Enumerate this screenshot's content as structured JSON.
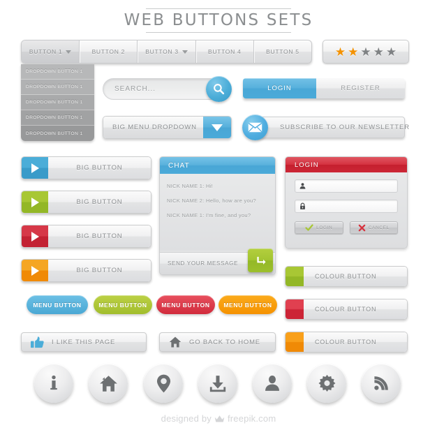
{
  "page": {
    "title": "WEB BUTTONS SETS"
  },
  "navbar": {
    "items": [
      {
        "label": "BUTTON 1",
        "has_caret": true,
        "active": true
      },
      {
        "label": "BUTTON 2",
        "has_caret": false,
        "active": false
      },
      {
        "label": "BUTTON 3",
        "has_caret": true,
        "active": false
      },
      {
        "label": "BUTTON 4",
        "has_caret": false,
        "active": false
      },
      {
        "label": "BUTTON 5",
        "has_caret": false,
        "active": false
      }
    ]
  },
  "rating": {
    "filled": 2,
    "total": 5,
    "filled_color": "#f39200",
    "empty_color": "#7f8284"
  },
  "dropdown": {
    "items": [
      {
        "label": "DROPDOWN BUTTON 1",
        "bg": "#b7b8b9"
      },
      {
        "label": "DROPDOWN BUTTON 1",
        "bg": "#b1b2b3"
      },
      {
        "label": "DROPDOWN BUTTON 1",
        "bg": "#a9aaab"
      },
      {
        "label": "DROPDOWN BUTTON 1",
        "bg": "#a1a2a3"
      },
      {
        "label": "DROPDOWN BUTTON 1",
        "bg": "#98999a"
      }
    ]
  },
  "search": {
    "placeholder": "SEARCH...",
    "icon": "search-icon",
    "accent": "#4badd8"
  },
  "auth_tabs": {
    "login_label": "LOGIN",
    "register_label": "REGISTER",
    "active": "LOGIN",
    "accent": "#4baad9"
  },
  "big_menu_dropdown": {
    "label": "BIG MENU DROPDOWN",
    "icon": "chevron-down-icon",
    "accent": "#4aaad9"
  },
  "newsletter": {
    "label": "SUBSCRIBE TO OUR NEWSLETTER",
    "icon": "envelope-icon",
    "accent": "#4fade0"
  },
  "big_buttons": [
    {
      "label": "BIG BUTTON",
      "color": "#4badd8",
      "color_dark": "#3a9bc9",
      "icon": "play-icon"
    },
    {
      "label": "BIG BUTTON",
      "color": "#a8c734",
      "color_dark": "#93b726",
      "icon": "play-icon"
    },
    {
      "label": "BIG BUTTON",
      "color": "#d63848",
      "color_dark": "#c32233",
      "icon": "play-icon"
    },
    {
      "label": "BIG BUTTON",
      "color": "#f5a623",
      "color_dark": "#f08a06",
      "icon": "play-icon"
    }
  ],
  "chat": {
    "title": "CHAT",
    "messages": [
      "NICK NAME 1: Hi!",
      "NICK NAME 2: Hello, how are you?",
      "NICK NAME 1: I'm fine, and you?"
    ],
    "input_placeholder": "SEND YOUR MESSAGE",
    "send_icon": "enter-arrow-icon",
    "header_color": "#4baad9",
    "send_color": "#a3c431"
  },
  "login_panel": {
    "title": "LOGIN",
    "header_color": "#cc2736",
    "fields": [
      {
        "icon": "user-icon",
        "value": ""
      },
      {
        "icon": "lock-icon",
        "value": ""
      }
    ],
    "submit_label": "LOGIN",
    "submit_icon": "check-icon",
    "cancel_label": "CANCEL",
    "cancel_icon": "cross-icon",
    "check_color": "#a8c734",
    "cross_color": "#d6333f"
  },
  "colour_buttons": [
    {
      "label": "COLOUR BUTTON",
      "color": "#a8c734",
      "color_dark": "#93b726"
    },
    {
      "label": "COLOUR BUTTON",
      "color": "#e04050",
      "color_dark": "#cc2436"
    },
    {
      "label": "COLOUR BUTTON",
      "color": "#f9a01b",
      "color_dark": "#f08a06"
    }
  ],
  "menu_pills": [
    {
      "label": "MENU BUTTON",
      "color": "#6cc0e5",
      "color_dark": "#4aa8d4"
    },
    {
      "label": "MENU BUTTON",
      "color": "#bcd145",
      "color_dark": "#a2bd2d"
    },
    {
      "label": "MENU BUTTON",
      "color": "#e8505e",
      "color_dark": "#d12b3c"
    },
    {
      "label": "MENU BUTTON",
      "color": "#fbab1c",
      "color_dark": "#f59200"
    }
  ],
  "action_buttons": [
    {
      "label": "I LIKE THIS PAGE",
      "icon": "thumbs-up-icon",
      "icon_color": "#4badd8"
    },
    {
      "label": "GO BACK TO HOME",
      "icon": "home-icon",
      "icon_color": "#6d7072"
    }
  ],
  "circle_icons": [
    {
      "icon": "info-icon"
    },
    {
      "icon": "home-icon"
    },
    {
      "icon": "location-pin-icon"
    },
    {
      "icon": "download-icon"
    },
    {
      "icon": "user-icon"
    },
    {
      "icon": "gear-icon"
    },
    {
      "icon": "rss-icon"
    }
  ],
  "footer": {
    "prefix": "designed by",
    "brand": "freepik.com",
    "icon": "crown-icon"
  }
}
